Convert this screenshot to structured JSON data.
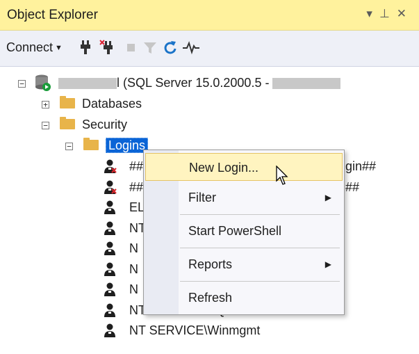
{
  "panel": {
    "title": "Object Explorer",
    "icons": "▾ ⊥ ✕"
  },
  "toolbar": {
    "connect_label": "Connect"
  },
  "tree": {
    "server_text": "l (SQL Server 15.0.2000.5 -",
    "databases": "Databases",
    "security": "Security",
    "logins": "Logins",
    "logins_items": [
      {
        "left": "##",
        "right": "gin##"
      },
      {
        "left": "##",
        "right": "##"
      },
      {
        "left": "EL",
        "right": ""
      },
      {
        "left": "NT",
        "right": ""
      },
      {
        "left": "N",
        "right": ""
      },
      {
        "left": "N",
        "right": ""
      },
      {
        "left": "N",
        "right": ""
      },
      {
        "left": "NT SERVICE\\SQLWriter",
        "right": ""
      },
      {
        "left": "NT SERVICE\\Winmgmt",
        "right": ""
      }
    ]
  },
  "context_menu": {
    "items": [
      "New Login...",
      "Filter",
      "Start PowerShell",
      "Reports",
      "Refresh"
    ]
  },
  "colors": {
    "title_bg": "#fff29d",
    "selection": "#0a64d6",
    "hover": "#fff4c0"
  }
}
